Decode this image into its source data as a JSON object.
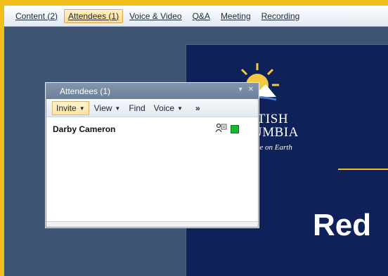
{
  "menubar": {
    "items": [
      {
        "label": "Content (2)"
      },
      {
        "label": "Attendees (1)",
        "active": true
      },
      {
        "label": "Voice & Video"
      },
      {
        "label": "Q&A"
      },
      {
        "label": "Meeting"
      },
      {
        "label": "Recording"
      }
    ]
  },
  "slide": {
    "logo_line1": "ITISH",
    "logo_line2": "UMBIA",
    "logo_tagline": "ace on Earth",
    "title": "Red"
  },
  "attendees_panel": {
    "title": "Attendees (1)",
    "toolbar": {
      "invite": "Invite",
      "view": "View",
      "find": "Find",
      "voice": "Voice",
      "more": "»"
    },
    "attendees": [
      {
        "name": "Darby Cameron",
        "status_color": "#16b82c"
      }
    ]
  },
  "colors": {
    "frame_accent": "#f2be1b",
    "workspace": "#3d5573",
    "slide_background": "#0e2158"
  },
  "icons": [
    "presenter-icon",
    "minimize-icon",
    "close-icon",
    "chevron-down-icon"
  ]
}
